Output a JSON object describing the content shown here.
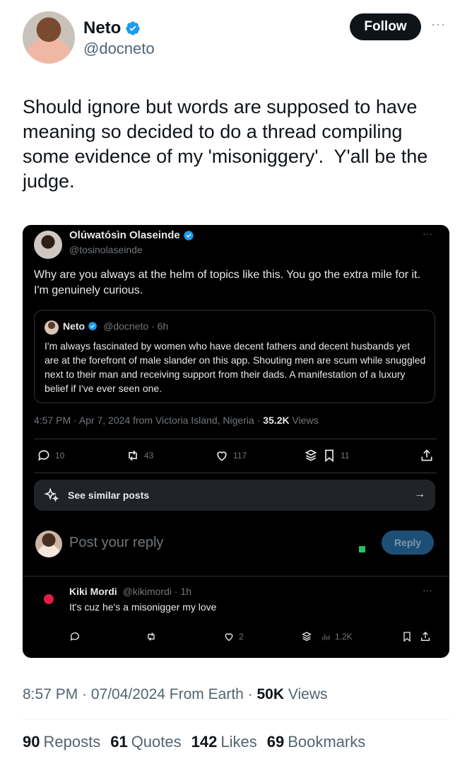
{
  "author": {
    "name": "Neto",
    "handle": "@docneto",
    "follow_label": "Follow",
    "more_label": "···"
  },
  "tweet": {
    "text": "Should ignore but words are supposed to have\nmeaning so decided to do a thread compiling\nsome evidence of my 'misoniggery'.  Y'all be the\njudge."
  },
  "embedded": {
    "author_name": "Olúwatósìn Olaseinde",
    "author_handle": "@tosinolaseinde",
    "more_label": "···",
    "text": "Why are you always at the helm of topics like this. You go the extra mile for it. I'm genuinely curious.",
    "quote": {
      "name": "Neto",
      "meta": "@docneto · 6h",
      "text": "I'm always fascinated by women who have decent fathers and decent husbands yet are at the forefront of male slander on this app. Shouting men are scum while snuggled next to their man and receiving support from their dads. A manifestation of a luxury belief if I've ever seen one."
    },
    "timestamp_prefix": "4:57 PM · Apr 7, 2024 from Victoria Island, Nigeria · ",
    "views_count": "35.2K",
    "views_label": " Views",
    "actions": {
      "replies": "10",
      "reposts": "43",
      "likes": "117",
      "bookmarks": "11"
    },
    "similar_label": "See similar posts",
    "similar_arrow": "→",
    "reply_placeholder": "Post your reply",
    "reply_button": "Reply",
    "reply_tweet": {
      "name": "Kiki Mordi",
      "meta": "@kikimordi · 1h",
      "more_label": "···",
      "text": "It's cuz he's a misonigger my love",
      "likes": "2",
      "views": "1.2K"
    }
  },
  "footer": {
    "time": "8:57 PM · 07/04/2024 From Earth · ",
    "views_count": "50K",
    "views_label": " Views",
    "reposts_count": "90",
    "reposts_label": "Reposts",
    "quotes_count": "61",
    "quotes_label": "Quotes",
    "likes_count": "142",
    "likes_label": "Likes",
    "bookmarks_count": "69",
    "bookmarks_label": "Bookmarks"
  },
  "colors": {
    "verified": "#1d9bf0",
    "accent_dark_button": "#1d4f76"
  }
}
